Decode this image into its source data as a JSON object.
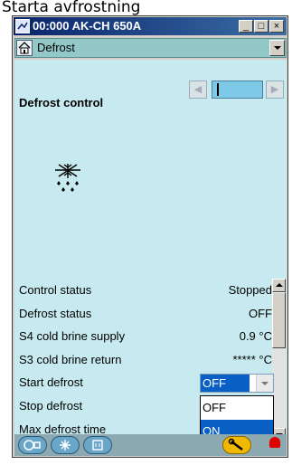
{
  "caption": "Starta avfrostning",
  "window": {
    "title": "00:000 AK-CH 650A",
    "minimize": "_",
    "maximize": "□",
    "close": "×"
  },
  "menu": {
    "selected": "Defrost"
  },
  "section_title": "Defrost control",
  "rows": [
    {
      "label": "Control status",
      "value": "Stopped"
    },
    {
      "label": "Defrost status",
      "value": "OFF"
    },
    {
      "label": "S4 cold brine supply",
      "value": "0.9 °C"
    },
    {
      "label": "S3 cold brine return",
      "value": "***** °C"
    },
    {
      "label": "Start defrost",
      "value": ""
    },
    {
      "label": "Stop defrost",
      "value": ""
    },
    {
      "label": "Max defrost time",
      "value": ""
    }
  ],
  "start_defrost_dropdown": {
    "selected": "OFF",
    "options": [
      "OFF",
      "ON"
    ],
    "highlighted": "ON"
  },
  "colors": {
    "accent": "#0a5fc4",
    "content_bg": "#c7eaf0",
    "titlebar": "#0a246a",
    "alarm": "#e00000"
  },
  "icons": [
    "home-icon",
    "snowflake-icon",
    "compressor-icon",
    "defrost-icon",
    "io-icon",
    "service-wrench-icon",
    "alarm-bell-icon"
  ]
}
